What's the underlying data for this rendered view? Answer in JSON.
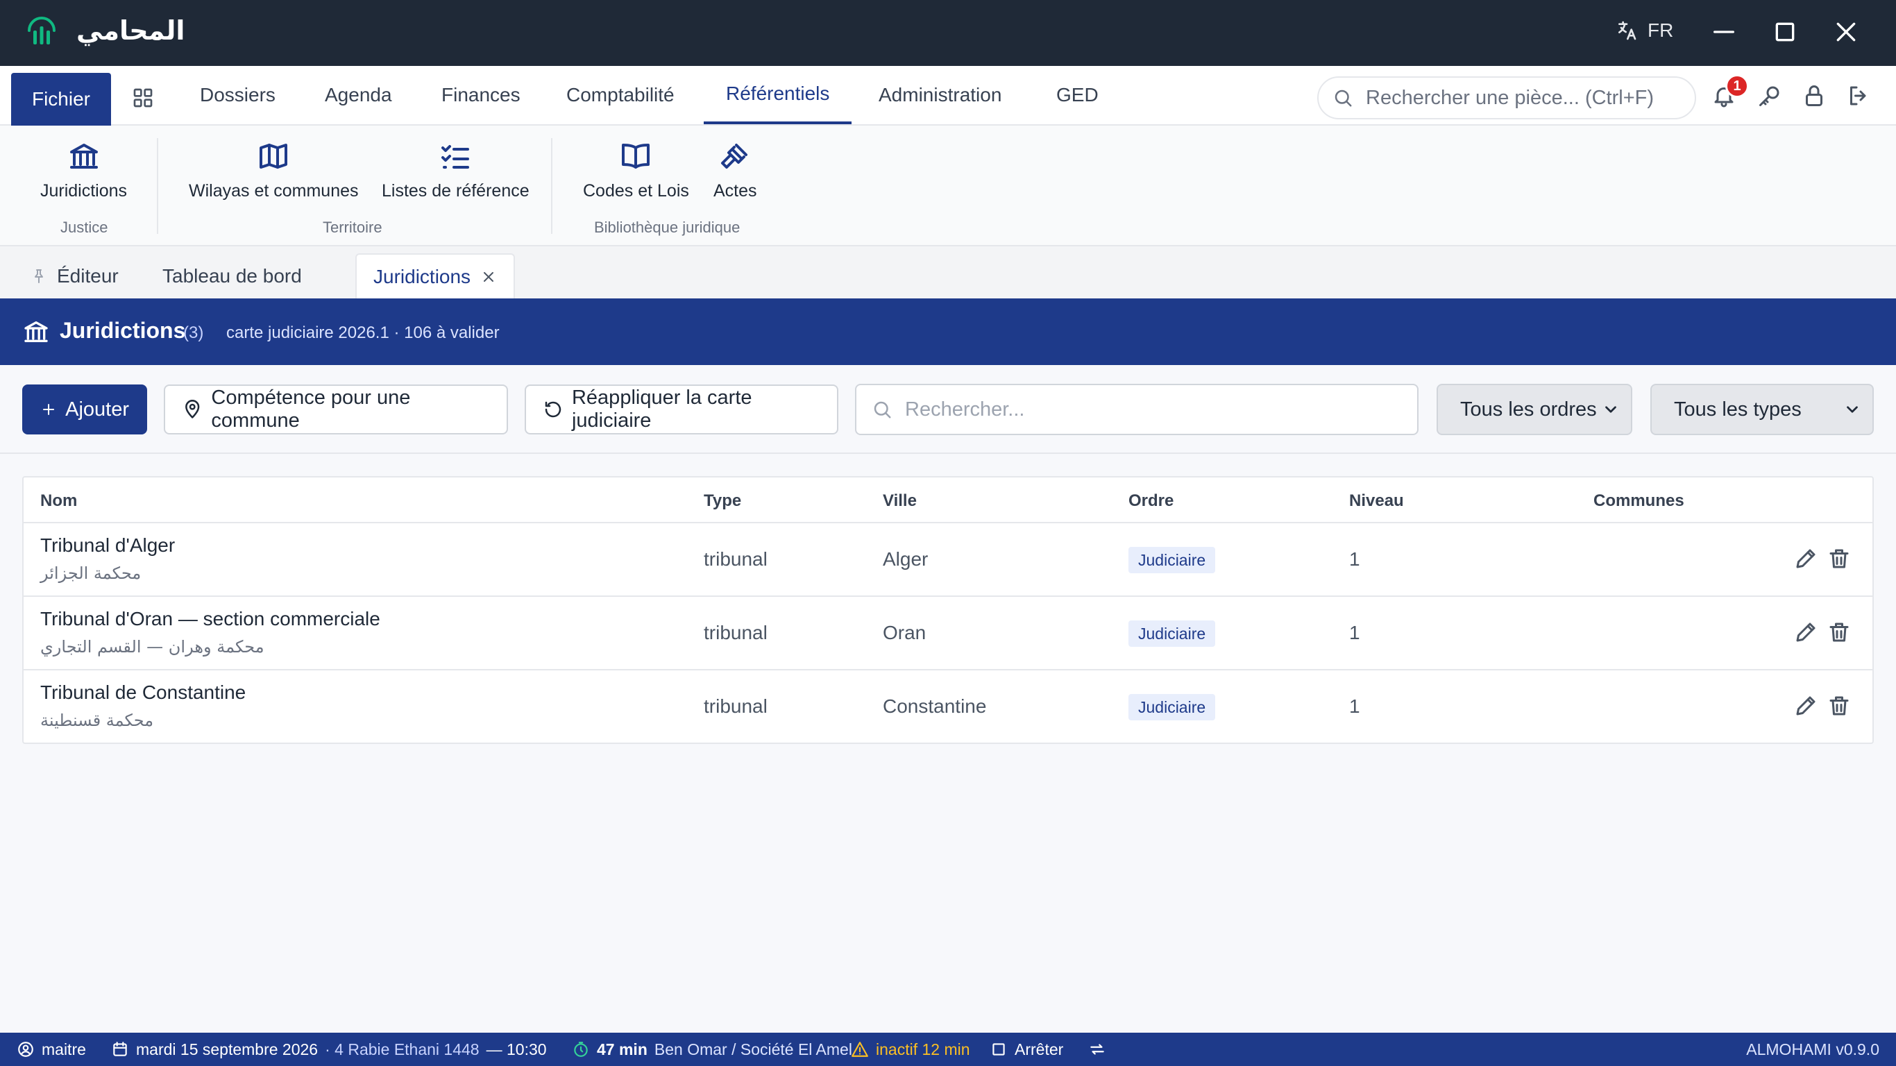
{
  "app": {
    "title": "المحامي",
    "lang": "FR",
    "accent": "#1e3a8a"
  },
  "menu": {
    "fichier": "Fichier",
    "items": [
      "Dossiers",
      "Agenda",
      "Finances",
      "Comptabilité",
      "Référentiels",
      "Administration",
      "GED"
    ],
    "search_placeholder": "Rechercher une pièce... (Ctrl+F)",
    "notif_count": "1"
  },
  "ribbon": {
    "buttons": [
      "Juridictions",
      "Wilayas et communes",
      "Listes de référence",
      "Codes et Lois",
      "Actes"
    ],
    "groups": [
      "Justice",
      "Territoire",
      "Bibliothèque juridique"
    ]
  },
  "tabs": [
    "Éditeur",
    "Tableau de bord",
    "Juridictions"
  ],
  "page": {
    "title": "Juridictions",
    "count": "(3)",
    "subtitle": "carte judiciaire 2026.1 · 106 à valider"
  },
  "toolbar": {
    "add": "Ajouter",
    "competence": "Compétence pour une commune",
    "reapply": "Réappliquer la carte judiciaire",
    "search_placeholder": "Rechercher...",
    "filter_orders": "Tous les ordres",
    "filter_types": "Tous les types"
  },
  "table": {
    "headers": [
      "Nom",
      "Type",
      "Ville",
      "Ordre",
      "Niveau",
      "Communes"
    ],
    "rows": [
      {
        "name": "Tribunal d'Alger",
        "name_ar": "محكمة الجزائر",
        "type": "tribunal",
        "city": "Alger",
        "order": "Judiciaire",
        "level": "1",
        "communes": ""
      },
      {
        "name": "Tribunal d'Oran — section commerciale",
        "name_ar": "محكمة وهران — القسم التجاري",
        "type": "tribunal",
        "city": "Oran",
        "order": "Judiciaire",
        "level": "1",
        "communes": ""
      },
      {
        "name": "Tribunal de Constantine",
        "name_ar": "محكمة قسنطينة",
        "type": "tribunal",
        "city": "Constantine",
        "order": "Judiciaire",
        "level": "1",
        "communes": ""
      }
    ]
  },
  "status": {
    "user": "maitre",
    "date": "mardi 15 septembre 2026",
    "hijri": "· 4 Rabie Ethani 1448",
    "time": "— 10:30",
    "timer": "47 min",
    "client": "Ben Omar / Société El Amel",
    "inactive": "inactif 12 min",
    "stop": "Arrêter",
    "version": "ALMOHAMI v0.9.0"
  }
}
